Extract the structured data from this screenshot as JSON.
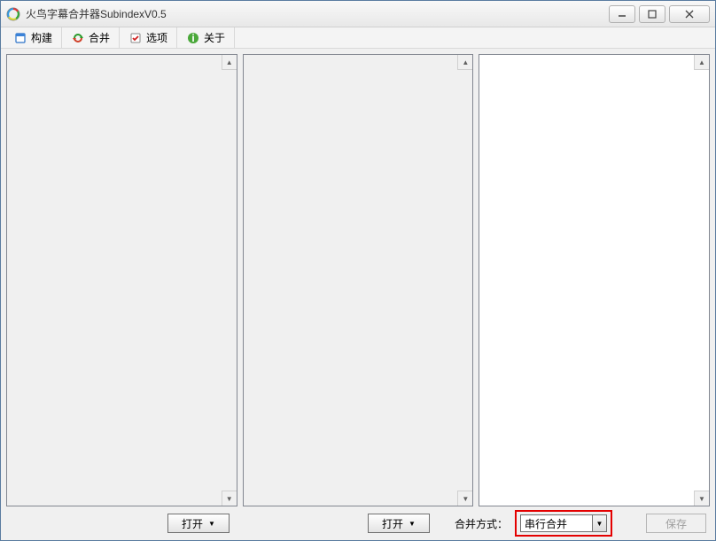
{
  "window": {
    "title": "火鸟字幕合并器SubindexV0.5"
  },
  "toolbar": {
    "build": "构建",
    "merge": "合并",
    "options": "选项",
    "about": "关于"
  },
  "bottom": {
    "open1": "打开",
    "open2": "打开",
    "merge_mode_label": "合并方式：",
    "merge_mode_value": "串行合并",
    "save": "保存"
  }
}
